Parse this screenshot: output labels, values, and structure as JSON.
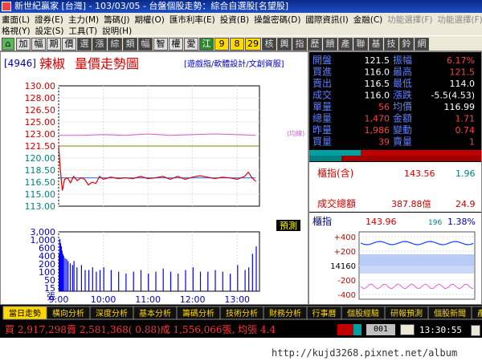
{
  "app": {
    "title": "新世紀贏家 [台灣] - 103/03/05 - 台盤個股走勢：綜合自選股[名望股]",
    "menu_row1": [
      "畫面(L)",
      "證券(E)",
      "主力(M)",
      "籌碼(J)",
      "期權(O)",
      "匯市利率(E)",
      "投資(B)",
      "操盤密碼(D)",
      "國際資訊(I)",
      "金融(C)",
      "功能選擇(F)",
      "功能選擇(F)"
    ],
    "menu_row2": [
      "格視(Y)",
      "設定(S)",
      "工具(T)",
      "說明(H)"
    ],
    "toolbar": [
      "加",
      "幅",
      "期",
      "價",
      "選",
      "漲",
      "綜",
      "類",
      "幅",
      "智",
      "權",
      "愛",
      "江",
      "9",
      "8",
      "29",
      "核",
      "輿",
      "指",
      "歷",
      "饋",
      "產",
      "聯",
      "基",
      "技",
      "鈴",
      "網"
    ]
  },
  "chart": {
    "code": "[4946]",
    "name": "辣椒",
    "title": "量價走勢圖",
    "links": "[遊戲指/軟體設計/文創資服]",
    "legend_mark": "(均線)",
    "predict": "預測"
  },
  "price_axis": {
    "ticks": [
      "130.00",
      "128.00",
      "126.50",
      "125.00",
      "123.00",
      "121.50",
      "120.00",
      "118.50",
      "116.50",
      "115.00",
      "113.00"
    ],
    "min": 113.0,
    "max": 130.0,
    "ref": 121.5
  },
  "volume_axis": {
    "ticks": [
      "3,000",
      "1,000",
      "600",
      "400",
      "200",
      "100",
      "50",
      "15",
      "張"
    ]
  },
  "time_axis": {
    "ticks": [
      "9:00",
      "10:00",
      "11:00",
      "12:00",
      "13:00"
    ]
  },
  "chart_data": {
    "type": "line",
    "x_unit": "minutes since 9:00",
    "price_series": {
      "name": "成交價",
      "x": [
        0,
        2,
        4,
        5,
        8,
        12,
        16,
        20,
        25,
        30,
        35,
        40,
        45,
        50,
        55,
        60,
        70,
        80,
        90,
        100,
        110,
        120,
        130,
        140,
        150,
        160,
        170,
        180,
        190,
        200,
        210,
        220,
        230,
        240,
        250,
        255,
        260,
        265
      ],
      "y": [
        121.5,
        118.5,
        116.2,
        115.2,
        116.8,
        117.0,
        116.3,
        117.2,
        116.6,
        117.0,
        116.8,
        116.0,
        116.4,
        116.2,
        117.2,
        116.8,
        117.1,
        116.9,
        117.0,
        116.9,
        117.2,
        116.9,
        117.0,
        117.2,
        116.8,
        117.2,
        116.8,
        117.1,
        117.3,
        117.1,
        116.9,
        117.1,
        117.0,
        116.8,
        117.2,
        117.8,
        117.0,
        116.5
      ]
    },
    "avg_series": {
      "name": "均價",
      "x": [
        0,
        20,
        40,
        60,
        100,
        140,
        180,
        220,
        265
      ],
      "y": [
        116.99,
        116.99,
        116.99,
        116.99,
        116.99,
        116.99,
        116.99,
        116.99,
        116.99
      ]
    },
    "upper_band": {
      "x": [
        0,
        30,
        60,
        90,
        120,
        150,
        180,
        210,
        240,
        265
      ],
      "y": [
        123.0,
        123.0,
        123.1,
        123.0,
        123.2,
        123.0,
        123.1,
        123.2,
        123.1,
        123.0
      ]
    },
    "volume": {
      "x": [
        0,
        1,
        2,
        3,
        4,
        5,
        6,
        8,
        10,
        12,
        15,
        18,
        20,
        24,
        30,
        35,
        40,
        45,
        50,
        55,
        60,
        70,
        80,
        90,
        100,
        110,
        120,
        130,
        140,
        150,
        160,
        170,
        180,
        190,
        200,
        210,
        220,
        230,
        240,
        250,
        255,
        260,
        265
      ],
      "y": [
        30,
        120,
        80,
        60,
        40,
        30,
        25,
        20,
        18,
        15,
        12,
        10,
        15,
        8,
        10,
        6,
        6,
        8,
        5,
        6,
        8,
        6,
        5,
        4,
        5,
        6,
        4,
        5,
        7,
        5,
        4,
        6,
        8,
        5,
        5,
        6,
        5,
        4,
        10,
        6,
        8,
        30,
        60
      ]
    },
    "ylim": [
      113.0,
      130.0
    ]
  },
  "quote": {
    "rows": [
      [
        "開盤",
        "121.5",
        "振幅",
        "6.17%"
      ],
      [
        "買進",
        "116.0",
        "最高",
        "121.5"
      ],
      [
        "賣出",
        "116.5",
        "最低",
        "114.0"
      ],
      [
        "成交",
        "116.0",
        "漲跌",
        "-5.5(4.53)"
      ],
      [
        "單量",
        "56",
        "均價",
        "116.99"
      ],
      [
        "總量",
        "1,470",
        "金額",
        "1.71"
      ],
      [
        "昨量",
        "1,986",
        "變動",
        "0.74"
      ],
      [
        "買量",
        "39",
        "賣量",
        "1"
      ]
    ]
  },
  "index_box": {
    "label": "櫃指(含)",
    "value": "143.56",
    "pct": "1.96",
    "total_label": "成交總額",
    "total_value": "387.88億",
    "total_pct": "24.9"
  },
  "otc_chart": {
    "label": "櫃指",
    "value": "143.96",
    "change": "196",
    "pct": "1.38%",
    "ticks": [
      "+400",
      "+200",
      "14160",
      "-200",
      "-400"
    ]
  },
  "tabs": [
    "當日走勢",
    "橫向分析",
    "深度分析",
    "基本分析",
    "籌碼分析",
    "技術分析",
    "財務分析",
    "行事曆",
    "個股經驗",
    "研報預測",
    "個股新聞",
    "產業分析"
  ],
  "summary": "買 2,917,298賣 2,581,368( 0.88)成 1,556,066張, 均張 4.4",
  "status_code": "001",
  "time": "13:30:55",
  "url": "http://kujd3268.pixnet.net/album",
  "colors": {
    "price": "#e00000",
    "avg": "#1060ff",
    "upper": "#d060d0",
    "ref": "#808000",
    "volume": "#0000ff",
    "quote_label": "#ff4040",
    "quote_value": "#ffffff",
    "bg_dark": "#000000"
  }
}
